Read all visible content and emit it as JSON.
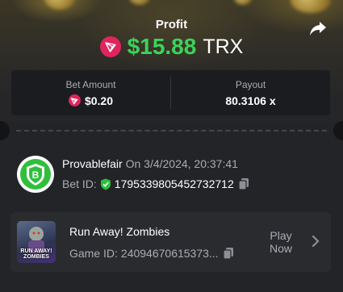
{
  "header": {
    "profit_label": "Profit",
    "profit_amount": "$15.88",
    "profit_currency": "TRX",
    "share_icon": "share-icon"
  },
  "stats": {
    "bet_amount_label": "Bet Amount",
    "bet_amount_value": "$0.20",
    "payout_label": "Payout",
    "payout_value": "80.3106 x"
  },
  "fairness": {
    "provider": "Provablefair",
    "timestamp": "On 3/4/2024, 20:37:41",
    "bet_id_label": "Bet ID:",
    "bet_id": "1795339805452732712"
  },
  "game": {
    "thumbnail_text": "RUN AWAY! ZOMBIES",
    "title": "Run Away! Zombies",
    "game_id_label": "Game ID:",
    "game_id": "24094670615373...",
    "play_label_line1": "Play",
    "play_label_line2": "Now"
  },
  "colors": {
    "profit_green": "#3bd35a",
    "trx_red": "#e0245e",
    "verified_green": "#2fbf3c"
  }
}
